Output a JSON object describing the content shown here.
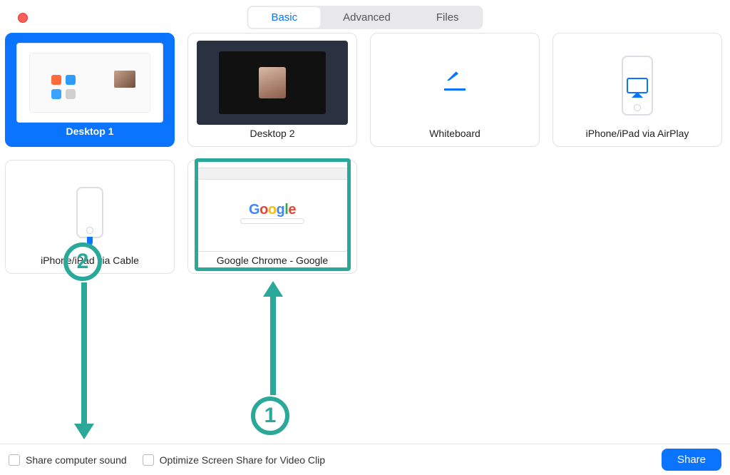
{
  "colors": {
    "accent": "#0a74ff",
    "annotation": "#2aa89a",
    "close": "#ff5f57"
  },
  "tabs": {
    "basic": "Basic",
    "advanced": "Advanced",
    "files": "Files",
    "active": "basic"
  },
  "options": {
    "desktop1": "Desktop 1",
    "desktop2": "Desktop 2",
    "whiteboard": "Whiteboard",
    "airplay": "iPhone/iPad via AirPlay",
    "cable": "iPhone/iPad via Cable",
    "chrome": "Google Chrome - Google",
    "selected": "desktop1"
  },
  "chrome_logo_letters": [
    "G",
    "o",
    "o",
    "g",
    "l",
    "e"
  ],
  "bottom": {
    "share_sound": "Share computer sound",
    "optimize": "Optimize Screen Share for Video Clip",
    "share_btn": "Share"
  },
  "annotations": {
    "step1": "1",
    "step2": "2"
  }
}
